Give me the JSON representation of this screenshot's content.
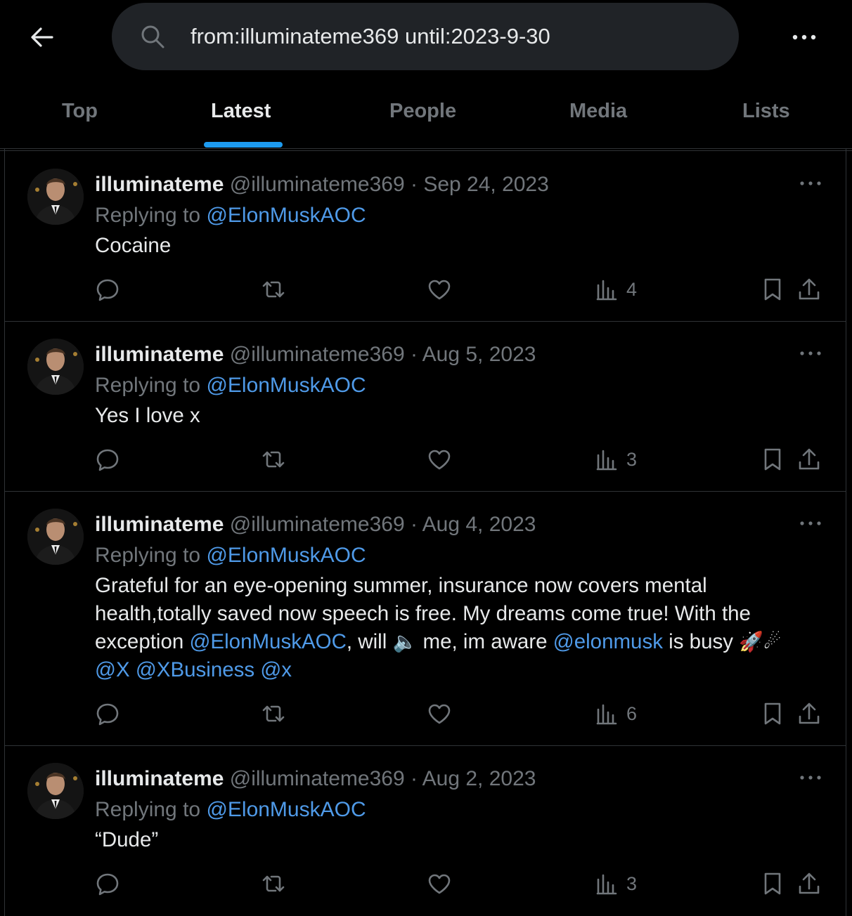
{
  "search": {
    "value": "from:illuminateme369 until:2023-9-30"
  },
  "tabs": [
    {
      "label": "Top"
    },
    {
      "label": "Latest"
    },
    {
      "label": "People"
    },
    {
      "label": "Media"
    },
    {
      "label": "Lists"
    }
  ],
  "active_tab": "Latest",
  "colors": {
    "accent": "#1d9bf0",
    "mention": "#4f9ae8",
    "background": "#000000",
    "muted": "#71767b"
  },
  "tweets": [
    {
      "name": "illuminateme",
      "handle": "@illuminateme369",
      "sep": " · ",
      "date": "Sep 24, 2023",
      "replying_prefix": "Replying to ",
      "replying_to": "@ElonMuskAOC",
      "text": "Cocaine",
      "views": "4"
    },
    {
      "name": "illuminateme",
      "handle": "@illuminateme369",
      "sep": " · ",
      "date": "Aug 5, 2023",
      "replying_prefix": "Replying to ",
      "replying_to": "@ElonMuskAOC",
      "text": "Yes I love x",
      "views": "3"
    },
    {
      "name": "illuminateme",
      "handle": "@illuminateme369",
      "sep": " · ",
      "date": "Aug 4, 2023",
      "replying_prefix": "Replying to ",
      "replying_to": "@ElonMuskAOC",
      "text_parts": {
        "p1": "Grateful for an eye-opening summer, insurance now covers mental health,totally  saved now speech is free. My  dreams come true! With the exception ",
        "m1": "@ElonMuskAOC",
        "p2": ", will ",
        "e1": "🔈",
        "p3": " me, im aware ",
        "m2": "@elonmusk",
        "p4": " is busy ",
        "e2": "🚀☄",
        "m3": "@X",
        "m4": "@XBusiness",
        "m5": "@x"
      },
      "views": "6"
    },
    {
      "name": "illuminateme",
      "handle": "@illuminateme369",
      "sep": " · ",
      "date": "Aug 2, 2023",
      "replying_prefix": "Replying to ",
      "replying_to": "@ElonMuskAOC",
      "text": "“Dude”",
      "views": "3"
    }
  ],
  "icons": [
    "back-arrow-icon",
    "search-icon",
    "more-icon",
    "reply-icon",
    "retweet-icon",
    "like-icon",
    "views-icon",
    "bookmark-icon",
    "share-icon"
  ]
}
